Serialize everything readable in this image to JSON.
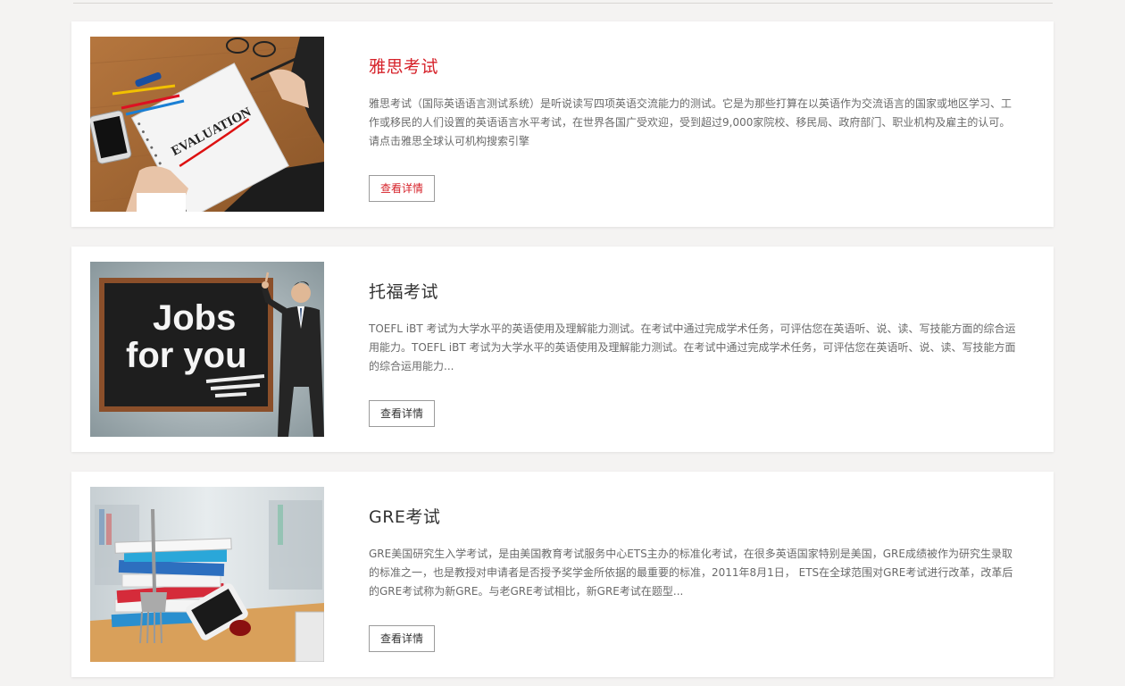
{
  "cards": [
    {
      "title": "雅思考试",
      "description": "雅思考试（国际英语语言测试系统）是听说读写四项英语交流能力的测试。它是为那些打算在以英语作为交流语言的国家或地区学习、工作或移民的人们设置的英语语言水平考试，在世界各国广受欢迎，受到超过9,000家院校、移民局、政府部门、职业机构及雇主的认可。请点击雅思全球认可机构搜索引擎",
      "button_label": "查看详情",
      "image_text": "EVALUATION",
      "image_icon": "evaluation-notebook-photo"
    },
    {
      "title": "托福考试",
      "description": "TOEFL iBT 考试为大学水平的英语使用及理解能力测试。在考试中通过完成学术任务，可评估您在英语听、说、读、写技能方面的综合运用能力。TOEFL iBT 考试为大学水平的英语使用及理解能力测试。在考试中通过完成学术任务，可评估您在英语听、说、读、写技能方面的综合运用能力...",
      "button_label": "查看详情",
      "image_text_line1": "Jobs",
      "image_text_line2": "for you",
      "image_icon": "jobs-chalkboard-photo"
    },
    {
      "title": "GRE考试",
      "description": "GRE美国研究生入学考试，是由美国教育考试服务中心ETS主办的标准化考试，在很多英语国家特别是美国，GRE成绩被作为研究生录取的标准之一，也是教授对申请者是否授予奖学金所依据的最重要的标准，2011年8月1日， ETS在全球范围对GRE考试进行改革，改革后的GRE考试称为新GRE。与老GRE考试相比，新GRE考试在题型...",
      "button_label": "查看详情",
      "image_icon": "books-stack-photo"
    }
  ],
  "colors": {
    "accent": "#d6222a",
    "background": "#f4f3f2",
    "card": "#ffffff",
    "text": "#333333",
    "muted_text": "#6a6a6a"
  }
}
